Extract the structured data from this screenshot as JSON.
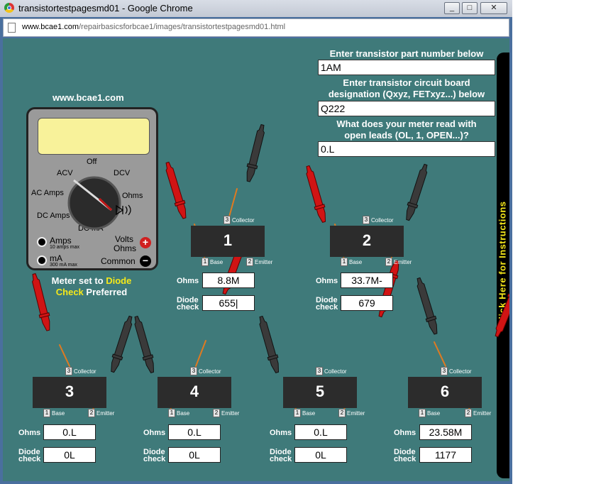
{
  "browser": {
    "title": "transistortestpagesmd01 - Google Chrome",
    "url_host": "www.bcae1.com",
    "url_path": "/repairbasicsforbcae1/images/transistortestpagesmd01.html",
    "controls": {
      "minimize": "_",
      "maximize": "□",
      "close": "✕"
    }
  },
  "site_label": "www.bcae1.com",
  "sidebar": {
    "label": "Click Here for Instructions"
  },
  "form": {
    "part_label": "Enter transistor part number below",
    "part_value": "1AM",
    "designation_label_1": "Enter transistor circuit board",
    "designation_label_2": "designation (Qxyz, FETxyz...) below",
    "designation_value": "Q222",
    "openleads_label_1": "What does your meter read with",
    "openleads_label_2": "open leads (OL, 1, OPEN...)?",
    "openleads_value": "0.L"
  },
  "meter": {
    "positions": {
      "off": "Off",
      "acv": "ACV",
      "dcv": "DCV",
      "ac_amps": "AC Amps",
      "ohms": "Ohms",
      "dc_amps": "DC Amps",
      "dc_ma": "DC mA"
    },
    "jacks": {
      "amps": "Amps",
      "amps_sub": "10 amps max",
      "ma": "mA",
      "ma_sub": "300 mA max",
      "volts": "Volts",
      "ohms": "Ohms",
      "common": "Common"
    },
    "plus": "+",
    "minus": "−"
  },
  "setting_note": {
    "prefix": "Meter set to ",
    "highlight_1": "Diode",
    "highlight_2": "Check",
    "suffix": " Preferred"
  },
  "pin_labels": {
    "collector": "Collector",
    "base": "Base",
    "emitter": "Emitter"
  },
  "row_labels": {
    "ohms": "Ohms",
    "diode_1": "Diode",
    "diode_2": "check"
  },
  "transistors": [
    {
      "number": "1",
      "pin_c": "3",
      "pin_b": "1",
      "pin_e": "2",
      "ohms": "8.8M",
      "diode": "655|"
    },
    {
      "number": "2",
      "pin_c": "3",
      "pin_b": "1",
      "pin_e": "2",
      "ohms": "33.7M-",
      "diode": "679"
    },
    {
      "number": "3",
      "pin_c": "3",
      "pin_b": "1",
      "pin_e": "2",
      "ohms": "0.L",
      "diode": "0L"
    },
    {
      "number": "4",
      "pin_c": "3",
      "pin_b": "1",
      "pin_e": "2",
      "ohms": "0.L",
      "diode": "0L"
    },
    {
      "number": "5",
      "pin_c": "3",
      "pin_b": "1",
      "pin_e": "2",
      "ohms": "0.L",
      "diode": "0L"
    },
    {
      "number": "6",
      "pin_c": "3",
      "pin_b": "1",
      "pin_e": "2",
      "ohms": "23.58M",
      "diode": "1177"
    }
  ],
  "colors": {
    "background": "#3f7a7a",
    "probe_red": "#d01414",
    "probe_black": "#3a3a3a",
    "lead": "#e07a20",
    "accent_yellow": "#f5e81a"
  }
}
